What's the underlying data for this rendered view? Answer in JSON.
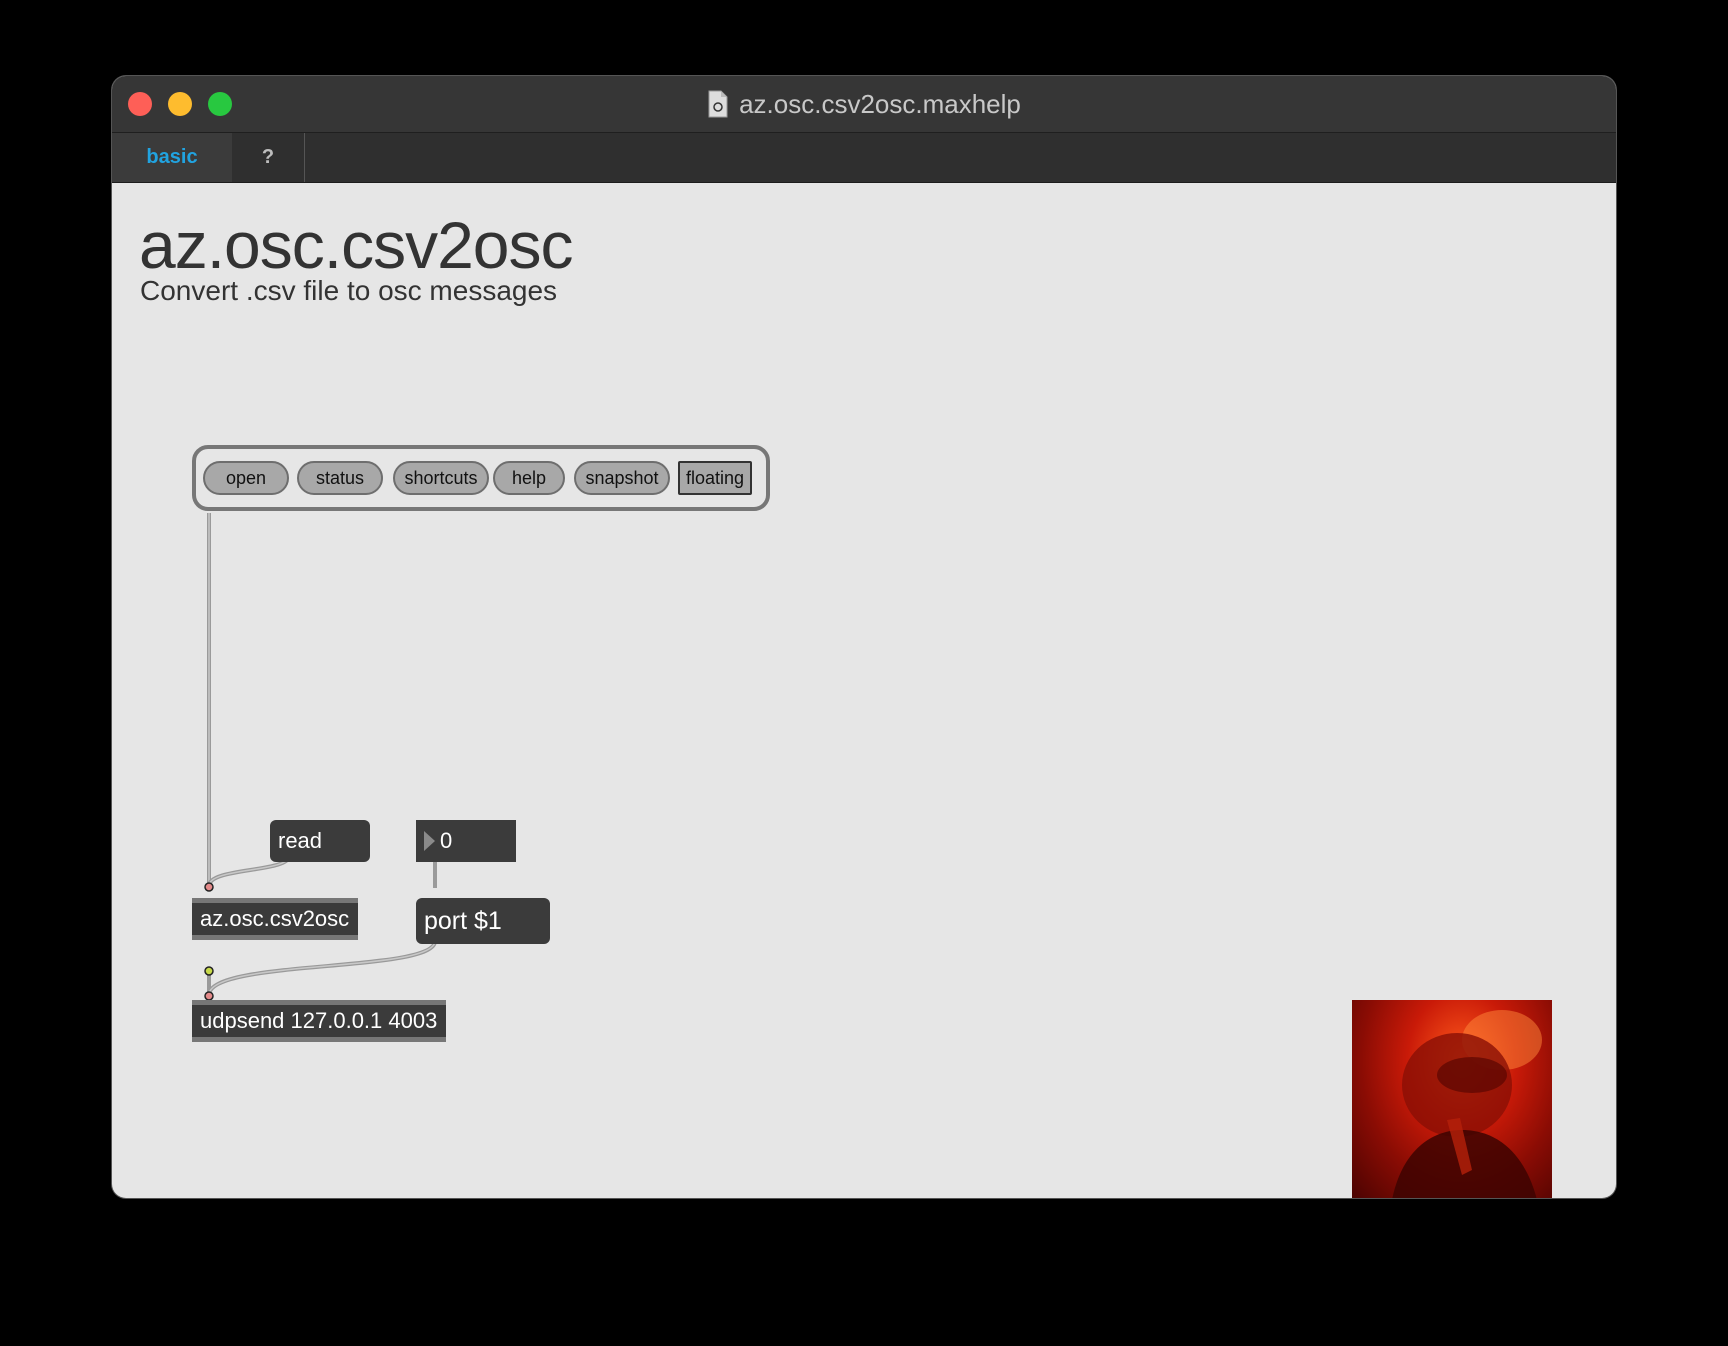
{
  "window": {
    "title": "az.osc.csv2osc.maxhelp"
  },
  "tabs": [
    {
      "label": "basic"
    },
    {
      "label": "?"
    }
  ],
  "header": {
    "title": "az.osc.csv2osc",
    "subtitle": "Convert .csv file to osc messages"
  },
  "panel": {
    "buttons": [
      "open",
      "status",
      "shortcuts",
      "help",
      "snapshot",
      "floating"
    ]
  },
  "patch": {
    "read_message": "read",
    "number_value": "0",
    "port_message": "port $1",
    "main_object": "az.osc.csv2osc",
    "udpsend_object": "udpsend 127.0.0.1 4003"
  },
  "colors": {
    "accent": "#21a3e0",
    "background": "#e6e6e6",
    "object_fill": "#3b3b3b"
  }
}
